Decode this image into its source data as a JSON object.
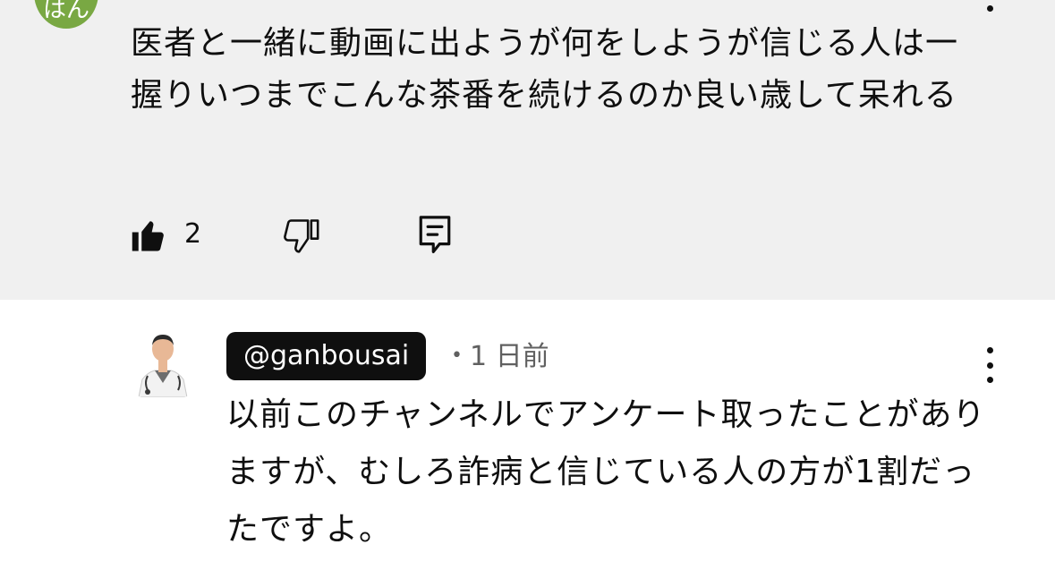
{
  "top_comment": {
    "avatar_text": "はん",
    "avatar_color": "#79a843",
    "text": "医者と一緒に動画に出ようが何をしようが信じる人は一握りいつまでこんな茶番を続けるのか良い歳して呆れる",
    "like_count": "2",
    "icons": [
      "thumb-up-filled-icon",
      "thumb-down-icon",
      "reply-icon",
      "more-vert-icon"
    ]
  },
  "reply": {
    "handle": "@ganbousai",
    "separator": "•",
    "time": "1 日前",
    "text": "以前このチャンネルでアンケート取ったことがありますが、むしろ詐病と信じている人の方が1割だったですよ。",
    "icons": [
      "avatar-doctor-image",
      "more-vert-icon"
    ]
  },
  "colors": {
    "top_background": "#f0f0f0",
    "text": "#0f0f0f",
    "secondary_text": "#606060",
    "handle_chip_bg": "#0f0f0f"
  }
}
